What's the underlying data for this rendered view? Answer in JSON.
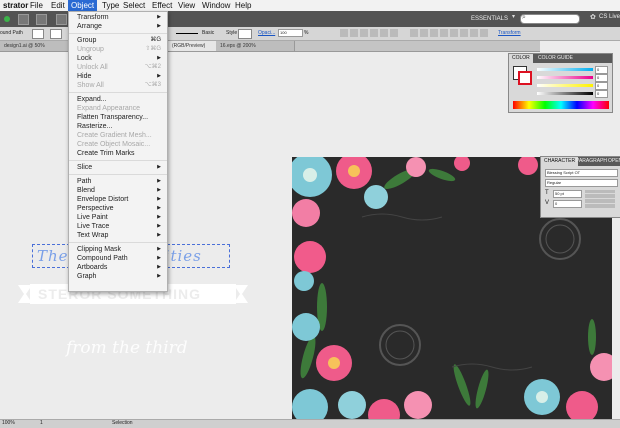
{
  "menubar": {
    "app": "strator",
    "items": [
      "File",
      "Edit",
      "Object",
      "Type",
      "Select",
      "Effect",
      "View",
      "Window",
      "Help"
    ]
  },
  "appbar": {
    "workspace": "ESSENTIALS",
    "cs_live": "CS Live",
    "search_placeholder": ""
  },
  "controlbar": {
    "left_label": "ound Path",
    "basic": "Basic",
    "style": "Style",
    "opacity_label": "Opaci...",
    "opacity_value": "100",
    "opacity_unit": "%",
    "transform": "Transform"
  },
  "tabs": [
    {
      "label": "design1.ai @ 50% (RGB...",
      "selected": false
    },
    {
      "label": "(RGB/Preview)",
      "selected": true
    },
    {
      "label": "16.eps @ 200% (RGB/Preview)",
      "selected": false
    }
  ],
  "object_menu": {
    "items": [
      {
        "label": "Transform",
        "shortcut": "",
        "submenu": true,
        "disabled": false
      },
      {
        "label": "Arrange",
        "shortcut": "",
        "submenu": true,
        "disabled": false
      },
      {
        "sep": true
      },
      {
        "label": "Group",
        "shortcut": "⌘G",
        "submenu": false,
        "disabled": false
      },
      {
        "label": "Ungroup",
        "shortcut": "⇧⌘G",
        "submenu": false,
        "disabled": true
      },
      {
        "label": "Lock",
        "shortcut": "",
        "submenu": true,
        "disabled": false
      },
      {
        "label": "Unlock All",
        "shortcut": "⌥⌘2",
        "submenu": false,
        "disabled": true
      },
      {
        "label": "Hide",
        "shortcut": "",
        "submenu": true,
        "disabled": false
      },
      {
        "label": "Show All",
        "shortcut": "⌥⌘3",
        "submenu": false,
        "disabled": true
      },
      {
        "sep": true
      },
      {
        "label": "Expand...",
        "shortcut": "",
        "submenu": false,
        "disabled": false
      },
      {
        "label": "Expand Appearance",
        "shortcut": "",
        "submenu": false,
        "disabled": true
      },
      {
        "label": "Flatten Transparency...",
        "shortcut": "",
        "submenu": false,
        "disabled": false
      },
      {
        "label": "Rasterize...",
        "shortcut": "",
        "submenu": false,
        "disabled": false
      },
      {
        "label": "Create Gradient Mesh...",
        "shortcut": "",
        "submenu": false,
        "disabled": true
      },
      {
        "label": "Create Object Mosaic...",
        "shortcut": "",
        "submenu": false,
        "disabled": true
      },
      {
        "label": "Create Trim Marks",
        "shortcut": "",
        "submenu": false,
        "disabled": false
      },
      {
        "sep": true
      },
      {
        "label": "Slice",
        "shortcut": "",
        "submenu": true,
        "disabled": false
      },
      {
        "sep": true
      },
      {
        "label": "Path",
        "shortcut": "",
        "submenu": true,
        "disabled": false
      },
      {
        "label": "Blend",
        "shortcut": "",
        "submenu": true,
        "disabled": false
      },
      {
        "label": "Envelope Distort",
        "shortcut": "",
        "submenu": true,
        "disabled": false
      },
      {
        "label": "Perspective",
        "shortcut": "",
        "submenu": true,
        "disabled": false
      },
      {
        "label": "Live Paint",
        "shortcut": "",
        "submenu": true,
        "disabled": false
      },
      {
        "label": "Live Trace",
        "shortcut": "",
        "submenu": true,
        "disabled": false
      },
      {
        "label": "Text Wrap",
        "shortcut": "",
        "submenu": true,
        "disabled": false
      },
      {
        "sep": true
      },
      {
        "label": "Clipping Mask",
        "shortcut": "",
        "submenu": true,
        "disabled": false
      },
      {
        "label": "Compound Path",
        "shortcut": "",
        "submenu": true,
        "disabled": false
      },
      {
        "label": "Artboards",
        "shortcut": "",
        "submenu": true,
        "disabled": false
      },
      {
        "label": "Graph",
        "shortcut": "",
        "submenu": true,
        "disabled": false
      }
    ]
  },
  "color_panel": {
    "tabs": [
      "COLOR",
      "COLOR GUIDE"
    ],
    "values": [
      "0",
      "0",
      "0",
      "0"
    ],
    "pct": "%"
  },
  "character_panel": {
    "tabs": [
      "CHARACTER",
      "PARAGRAPH",
      "OPEN"
    ],
    "font": "Blessing Script OT",
    "style": "Regular",
    "size": "50 pt",
    "leading": "0"
  },
  "artwork": {
    "script_line": "The ... ... ...sorities",
    "banner": "STEROR SOMETHING",
    "tagline": "from the third"
  },
  "statusbar": {
    "zoom": "100%",
    "page": "1",
    "tool": "Selection"
  },
  "colors": {
    "menu_highlight": "#2a6ad3",
    "artboard_bg": "#2a2a2a",
    "app_bar": "#535353",
    "accent_cyan": "#00aeef",
    "accent_magenta": "#ec008c"
  }
}
